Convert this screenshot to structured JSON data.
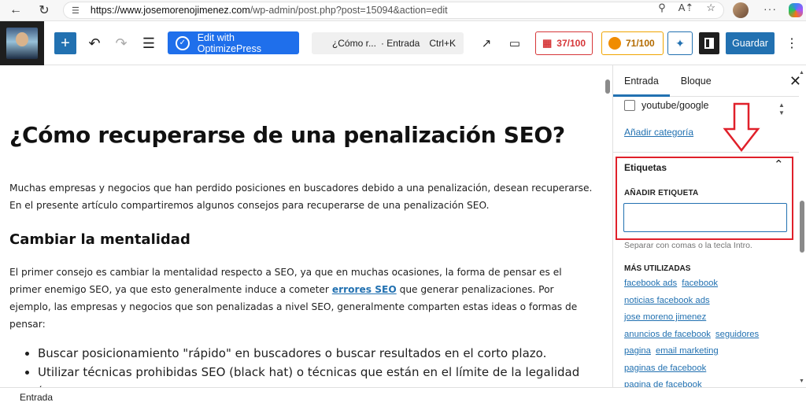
{
  "browser": {
    "url_host": "https://www.josemorenojimenez.com",
    "url_path": "/wp-admin/post.php?post=15094&action=edit"
  },
  "toolbar": {
    "add_label": "+",
    "optimize_label": "Edit with OptimizePress",
    "doc_title": "¿Cómo r...",
    "doc_type": "· Entrada",
    "shortcut": "Ctrl+K",
    "score_red": "37/100",
    "score_orange": "71/100",
    "save_label": "Guardar"
  },
  "content": {
    "title": "¿Cómo recuperarse de una penalización SEO?",
    "intro": "Muchas empresas y negocios que han perdido posiciones en buscadores debido a una penalización, desean recuperarse. En el presente artículo compartiremos algunos consejos para recuperarse de una penalización SEO.",
    "heading2": "Cambiar la mentalidad",
    "body_before_link": "El primer consejo es cambiar la mentalidad respecto a SEO, ya que en muchas ocasiones, la forma de pensar es el primer enemigo SEO, ya que esto generalmente induce a cometer ",
    "body_link": "errores SEO",
    "body_after_link": " que generar penalizaciones. Por ejemplo, las empresas y negocios que son penalizadas a nivel SEO, generalmente comparten estas ideas o formas de pensar:",
    "bullets": [
      "Buscar posicionamiento \"rápido\" en buscadores o buscar resultados en el corto plazo.",
      "Utilizar técnicas prohibidas SEO (black hat) o técnicas que están en el límite de la legalidad (grey"
    ]
  },
  "sidebar": {
    "tab_post": "Entrada",
    "tab_block": "Bloque",
    "category_item": "youtube/google",
    "add_category": "Añadir categoría",
    "tags_title": "Etiquetas",
    "add_tag_label": "AÑADIR ETIQUETA",
    "tag_input_value": "",
    "tag_help": "Separar con comas o la tecla Intro.",
    "most_used_label": "MÁS UTILIZADAS",
    "tags": [
      "facebook ads",
      "facebook",
      "noticias facebook ads",
      "jose moreno jimenez",
      "anuncios de facebook",
      "seguidores",
      "pagina",
      "email marketing",
      "paginas de facebook",
      "pagina de facebook"
    ]
  },
  "footer": {
    "breadcrumb": "Entrada"
  },
  "colors": {
    "accent": "#2271b1",
    "optimize": "#1f6feb",
    "annotation": "#e0202a"
  }
}
